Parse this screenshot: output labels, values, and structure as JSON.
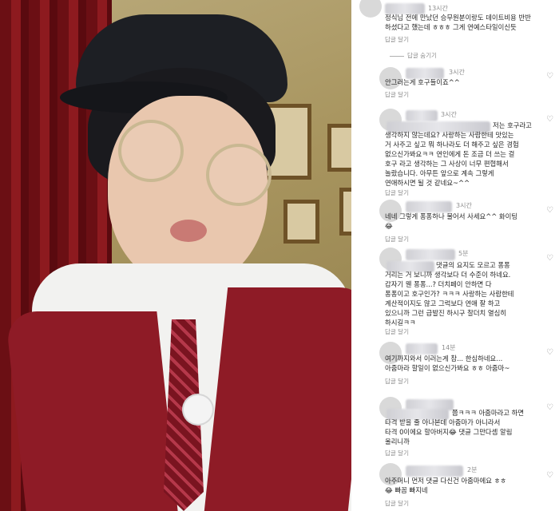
{
  "comments": [
    {
      "time": "13시간",
      "text": "정식님 전에 만났던 승무원분이랑도 데이트비용 반반\n하셨다고 했는데 ㅎㅎㅎ 그게 연예스타일이신듯",
      "reply": "답글 달기"
    },
    {
      "time": "3시간",
      "text": "안그러는게 호구들이죠^^",
      "reply": "답글 달기"
    },
    {
      "time": "3시간",
      "text": "저는 호구라고\n생각하지 않는데요? 사랑하는 사람한테 맛있는\n거 사주고 싶고 뭐 하나라도 더 해주고 싶은 경험\n없으신가봐요ㅋㅋ 연인에게 돈 조금 더 쓰는 걸\n호구 라고 생각하는 그 사상이 너무 편협해서\n놀랐습니다. 아무튼 앞으로 계속 그렇게\n연애하시면 될 것 같네요~^^",
      "reply": "답글 달기"
    },
    {
      "time": "3시간",
      "text": "네네 그렇게 퐁퐁하나 물어서 사세요^^ 화이팅\n😂",
      "reply": "답글 달기"
    },
    {
      "time": "5분",
      "text": "댓글의 요지도 모르고 퐁퐁\n거리는 거 보니까 생각보다 더 수준이 하네요.\n갑자기 웬 퐁퐁...? 더치페이 안하면 다\n퐁퐁이고 호구인가? ㅋㅋㅋ 사랑하는 사람한테\n계산적이지도 않고 그럭보다 연애 잘 하고\n있으니까 그런 급발진 하시구 찰더치 열심히\n하시길ㅋㅋ",
      "reply": "답글 달기"
    },
    {
      "time": "14분",
      "text": "여기까지와서 이러는게 참... 한심하네요...\n아줌마라 할일이 없으신가봐요 ㅎㅎ 아줌마~",
      "reply": "답글 달기"
    },
    {
      "time": "",
      "text": "쯤ㅋㅋㅋ 아줌마라고 하면\n타격 받을 줄 아나본데 아줌마가 아니라서\n타격 0이에요 할아버지😂 댓글 그만다셈 알림\n울리니까",
      "reply": "답글 달기"
    },
    {
      "time": "2분",
      "text": "아주머니 먼저 댓글 다신건 아줌마에요 ㅎㅎ\n😂 빠꼼 빠지네",
      "reply": "답글 달기"
    }
  ],
  "hide_replies_label": "답글 숨기기"
}
